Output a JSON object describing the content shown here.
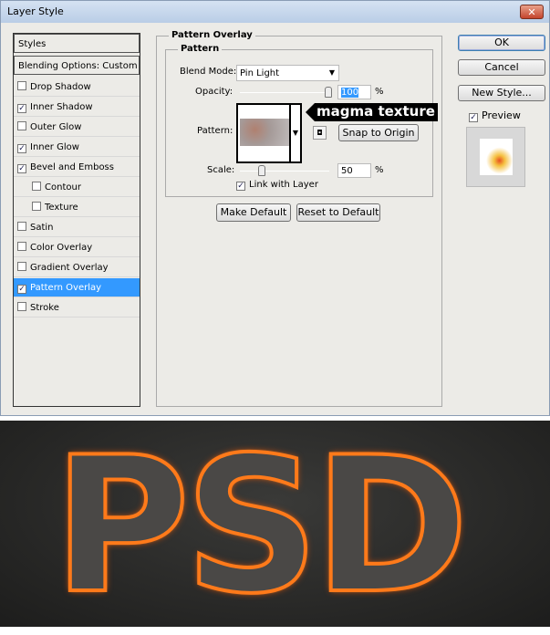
{
  "window": {
    "title": "Layer Style",
    "close_icon": "close-icon"
  },
  "styles_list": {
    "items": [
      {
        "label": "Styles",
        "checkbox": false
      },
      {
        "label": "Blending Options: Custom",
        "checkbox": false
      },
      {
        "label": "Drop Shadow",
        "checkbox": true,
        "checked": false
      },
      {
        "label": "Inner Shadow",
        "checkbox": true,
        "checked": true
      },
      {
        "label": "Outer Glow",
        "checkbox": true,
        "checked": false
      },
      {
        "label": "Inner Glow",
        "checkbox": true,
        "checked": true
      },
      {
        "label": "Bevel and Emboss",
        "checkbox": true,
        "checked": true
      },
      {
        "label": "Contour",
        "checkbox": true,
        "checked": false,
        "indent": true
      },
      {
        "label": "Texture",
        "checkbox": true,
        "checked": false,
        "indent": true
      },
      {
        "label": "Satin",
        "checkbox": true,
        "checked": false
      },
      {
        "label": "Color Overlay",
        "checkbox": true,
        "checked": false
      },
      {
        "label": "Gradient Overlay",
        "checkbox": true,
        "checked": false
      },
      {
        "label": "Pattern Overlay",
        "checkbox": true,
        "checked": true,
        "selected": true
      },
      {
        "label": "Stroke",
        "checkbox": true,
        "checked": false
      }
    ]
  },
  "pattern_overlay": {
    "title": "Pattern Overlay",
    "group": "Pattern",
    "blend_mode_label": "Blend Mode:",
    "blend_mode": "Pin Light",
    "opacity_label": "Opacity:",
    "opacity": "100",
    "opacity_unit": "%",
    "pattern_label": "Pattern:",
    "pattern_callout": "magma texture",
    "snap_button": "Snap to Origin",
    "scale_label": "Scale:",
    "scale": "50",
    "scale_unit": "%",
    "link_label": "Link with Layer",
    "link_checked": true,
    "make_default": "Make Default",
    "reset_default": "Reset to Default"
  },
  "side": {
    "ok": "OK",
    "cancel": "Cancel",
    "new_style": "New Style...",
    "preview_label": "Preview",
    "preview_checked": true
  },
  "artwork": {
    "text": "PSD"
  },
  "colors": {
    "selection": "#3399ff",
    "glow": "#ff7a1a"
  }
}
